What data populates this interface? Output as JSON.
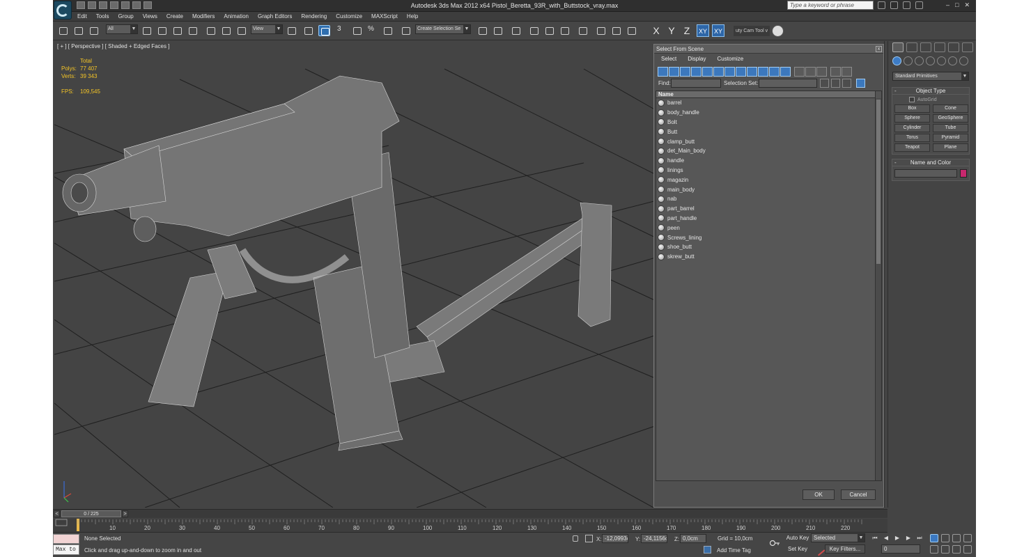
{
  "window": {
    "title": "Autodesk 3ds Max  2012 x64     Pistol_Beretta_93R_with_Buttstock_vray.max",
    "search_placeholder": "Type a keyword or phrase",
    "minimize": "–",
    "maximize": "□",
    "close": "✕"
  },
  "menu": [
    "Edit",
    "Tools",
    "Group",
    "Views",
    "Create",
    "Modifiers",
    "Animation",
    "Graph Editors",
    "Rendering",
    "Customize",
    "MAXScript",
    "Help"
  ],
  "toolbar": {
    "selection_filter": "All",
    "reference_coord": "View",
    "snap_label": "3",
    "angle_label": "%",
    "named_selection": "Create Selection Se",
    "axis_x": "X",
    "axis_y": "Y",
    "axis_z": "Z",
    "axis_xy": "XY",
    "axis_xy2": "XY",
    "cam_tool": "uty Cam Tool v"
  },
  "viewport": {
    "label": "[ + ] [ Perspective ] [ Shaded + Edged Faces ]",
    "stats": {
      "total": "Total",
      "polys_label": "Polys:",
      "polys": "77 407",
      "verts_label": "Verts:",
      "verts": "39 343",
      "fps_label": "FPS:",
      "fps": "109,545"
    }
  },
  "dialog": {
    "title": "Select From Scene",
    "close": "x",
    "menu": [
      "Select",
      "Display",
      "Customize"
    ],
    "find_label": "Find:",
    "selection_set_label": "Selection Set:",
    "column_name": "Name",
    "items": [
      "barrel",
      "body_handle",
      "Bolt",
      "Butt",
      "clamp_butt",
      "det_Main_body",
      "handle",
      "linings",
      "magazin",
      "main_body",
      "nab",
      "part_barrel",
      "part_handle",
      "peen",
      "Screws_lining",
      "shoe_butt",
      "skrew_butt"
    ],
    "ok": "OK",
    "cancel": "Cancel"
  },
  "command_panel": {
    "category": "Standard Primitives",
    "object_type_title": "Object Type",
    "autogrid": "AutoGrid",
    "primitives": [
      "Box",
      "Cone",
      "Sphere",
      "GeoSphere",
      "Cylinder",
      "Tube",
      "Torus",
      "Pyramid",
      "Teapot",
      "Plane"
    ],
    "name_color_title": "Name and Color",
    "object_color": "#c8286e"
  },
  "timeline": {
    "frame_display": "0 / 225",
    "prev": "<",
    "next": ">",
    "ticks": [
      "10",
      "20",
      "30",
      "40",
      "50",
      "60",
      "70",
      "80",
      "90",
      "100",
      "110",
      "120",
      "130",
      "140",
      "150",
      "160",
      "170",
      "180",
      "190",
      "200",
      "210",
      "220"
    ]
  },
  "status": {
    "maxscript": "Max to",
    "selection": "None Selected",
    "prompt": "Click and drag up-and-down to zoom in and out",
    "x_label": "X:",
    "x": "-12,0993cr",
    "y_label": "Y:",
    "y": "-24,1156cr",
    "z_label": "Z:",
    "z": "0,0cm",
    "grid": "Grid = 10,0cm",
    "add_time_tag": "Add Time Tag",
    "auto_key": "Auto Key",
    "set_key": "Set Key",
    "key_mode": "Selected",
    "key_filters": "Key Filters...",
    "current_frame": "0"
  }
}
